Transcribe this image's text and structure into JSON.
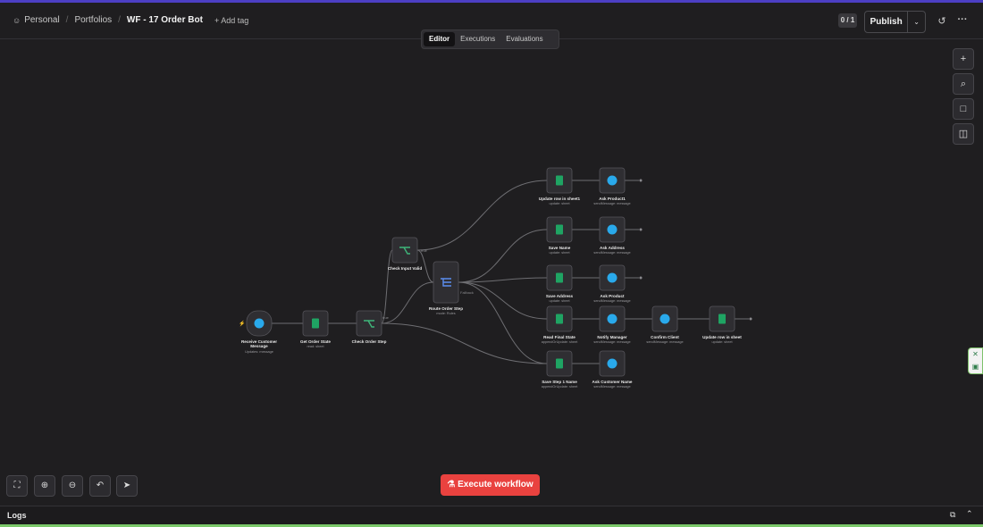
{
  "header": {
    "breadcrumb": [
      "Personal",
      "Portfolios"
    ],
    "title": "WF - 17 Order Bot",
    "add_tag": "+ Add tag",
    "counter": "0 / 1",
    "publish": "Publish"
  },
  "tabs": [
    "Editor",
    "Executions",
    "Evaluations"
  ],
  "active_tab": "Editor",
  "execute_label": "Execute workflow",
  "logs_label": "Logs",
  "colors": {
    "accent_red": "#e9423f",
    "sheets_green": "#1fa463",
    "telegram_blue": "#29a9eb",
    "switch_blue": "#5b8def",
    "if_green": "#3fb67a"
  },
  "nodes": [
    {
      "id": "receive",
      "label": "Receive Customer Message",
      "sub": "Updates: message",
      "icon": "telegram"
    },
    {
      "id": "getstate",
      "label": "Get Order State",
      "sub": "read: sheet",
      "icon": "sheets"
    },
    {
      "id": "checkstep",
      "label": "Check Order Step",
      "sub": "",
      "icon": "if"
    },
    {
      "id": "checkinput",
      "label": "Check Input Valid",
      "sub": "",
      "icon": "if"
    },
    {
      "id": "route",
      "label": "Route Order Step",
      "sub": "mode: Rules",
      "icon": "switch"
    },
    {
      "id": "upd1",
      "label": "Update row in sheet1",
      "sub": "update: sheet",
      "icon": "sheets"
    },
    {
      "id": "askp1",
      "label": "Ask Product1",
      "sub": "sendMessage: message",
      "icon": "telegram"
    },
    {
      "id": "savename",
      "label": "Save Name",
      "sub": "update: sheet",
      "icon": "sheets"
    },
    {
      "id": "askaddr",
      "label": "Ask Address",
      "sub": "sendMessage: message",
      "icon": "telegram"
    },
    {
      "id": "saveaddr",
      "label": "Save Address",
      "sub": "update: sheet",
      "icon": "sheets"
    },
    {
      "id": "askprod",
      "label": "Ask Product",
      "sub": "sendMessage: message",
      "icon": "telegram"
    },
    {
      "id": "readfinal",
      "label": "Read Final State",
      "sub": "appendOrUpdate: sheet",
      "icon": "sheets"
    },
    {
      "id": "notify",
      "label": "Notify Manager",
      "sub": "sendMessage: message",
      "icon": "telegram"
    },
    {
      "id": "confirm",
      "label": "Confirm Client",
      "sub": "sendMessage: message",
      "icon": "telegram"
    },
    {
      "id": "updrow",
      "label": "Update row in sheet",
      "sub": "update: sheet",
      "icon": "sheets"
    },
    {
      "id": "savestep1",
      "label": "Save Step 1 Name",
      "sub": "appendOrUpdate: sheet",
      "icon": "sheets"
    },
    {
      "id": "askcust",
      "label": "Ask Customer Name",
      "sub": "sendMessage: message",
      "icon": "telegram"
    }
  ],
  "edge_labels": {
    "true": "true",
    "fallback": "Fallback"
  },
  "icons": {
    "user": "user-icon",
    "plus": "plus-icon",
    "search": "search-icon",
    "note": "sticky-note-icon",
    "panel": "panel-icon",
    "history": "history-icon",
    "more": "more-icon"
  }
}
